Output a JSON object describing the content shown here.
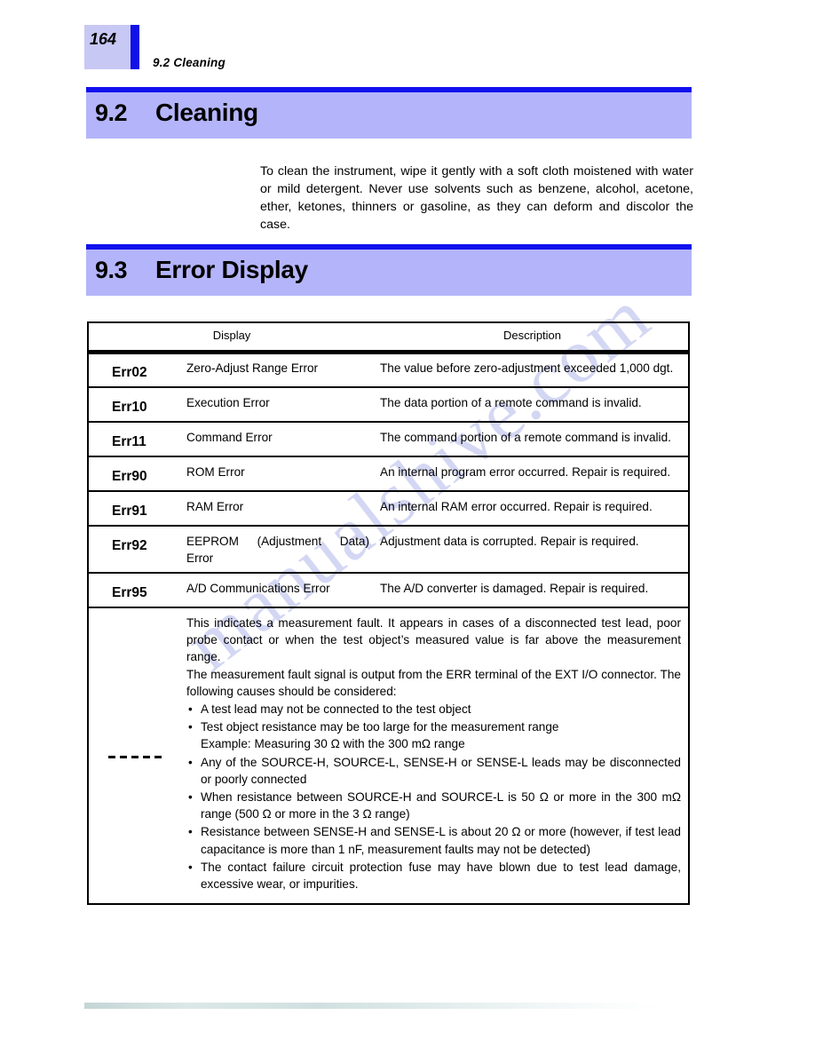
{
  "header": {
    "page_number": "164",
    "running_head": "9.2  Cleaning"
  },
  "sections": [
    {
      "number": "9.2",
      "title": "Cleaning",
      "body": "To clean the instrument, wipe it gently with a soft cloth moistened with water or mild detergent. Never use solvents such as benzene, alcohol, acetone, ether, ketones, thinners or gasoline, as they can deform and discolor the case."
    },
    {
      "number": "9.3",
      "title": "Error Display"
    }
  ],
  "table": {
    "columns": {
      "display": "Display",
      "description": "Description"
    },
    "rows": [
      {
        "code": "Err02",
        "name": "Zero-Adjust Range Error",
        "description": "The value before zero-adjustment exceeded 1,000 dgt."
      },
      {
        "code": "Err10",
        "name": "Execution Error",
        "description": "The data portion of a remote command is invalid."
      },
      {
        "code": "Err11",
        "name": "Command Error",
        "description": "The command portion of a remote command is invalid."
      },
      {
        "code": "Err90",
        "name": "ROM Error",
        "description": "An internal program error occurred. Repair is required."
      },
      {
        "code": "Err91",
        "name": "RAM Error",
        "description": "An internal RAM error occurred. Repair is required."
      },
      {
        "code": "Err92",
        "name": "EEPROM (Adjustment Data) Error",
        "description": "Adjustment data is corrupted. Repair is required."
      },
      {
        "code": "Err95",
        "name": "A/D Communications Error",
        "description": "The A/D converter is damaged. Repair is required."
      }
    ],
    "fault_row": {
      "display_indicator": "- - - - -",
      "display_dash_count": 5,
      "paragraph_1": "This indicates a measurement fault. It appears in cases of a disconnected test lead, poor probe contact or when the test object’s measured value is far above the measurement range.",
      "paragraph_2": "The measurement fault signal is output from the ERR terminal of the EXT I/O connector. The following causes should be considered:",
      "bullet_char": "•",
      "bullets": [
        {
          "text": "A test lead may not be connected to the test object",
          "sub": ""
        },
        {
          "text": "Test object resistance may be too large for the measurement range",
          "sub": "Example: Measuring 30 Ω with the 300 mΩ range"
        },
        {
          "text": "Any of the SOURCE-H, SOURCE-L, SENSE-H or SENSE-L leads may be disconnected or poorly connected",
          "sub": ""
        },
        {
          "text": "When resistance between SOURCE-H and SOURCE-L is 50 Ω or more in the 300 mΩ range (500 Ω or more in the 3 Ω range)",
          "sub": ""
        },
        {
          "text": "Resistance between SENSE-H and SENSE-L is about 20 Ω or more (however, if test lead capacitance is more than 1 nF, measurement faults may not be detected)",
          "sub": ""
        },
        {
          "text": "The contact failure circuit protection fuse may have blown due to test lead damage, excessive wear, or impurities.",
          "sub": ""
        }
      ]
    }
  },
  "watermark": {
    "text": "manualshive.com"
  },
  "colors": {
    "accent_blue": "#1111ee",
    "band_fill": "#b4b4fa",
    "pagenum_fill": "#c8c8f4",
    "text": "#000000",
    "watermark": "#c9cdf0"
  }
}
